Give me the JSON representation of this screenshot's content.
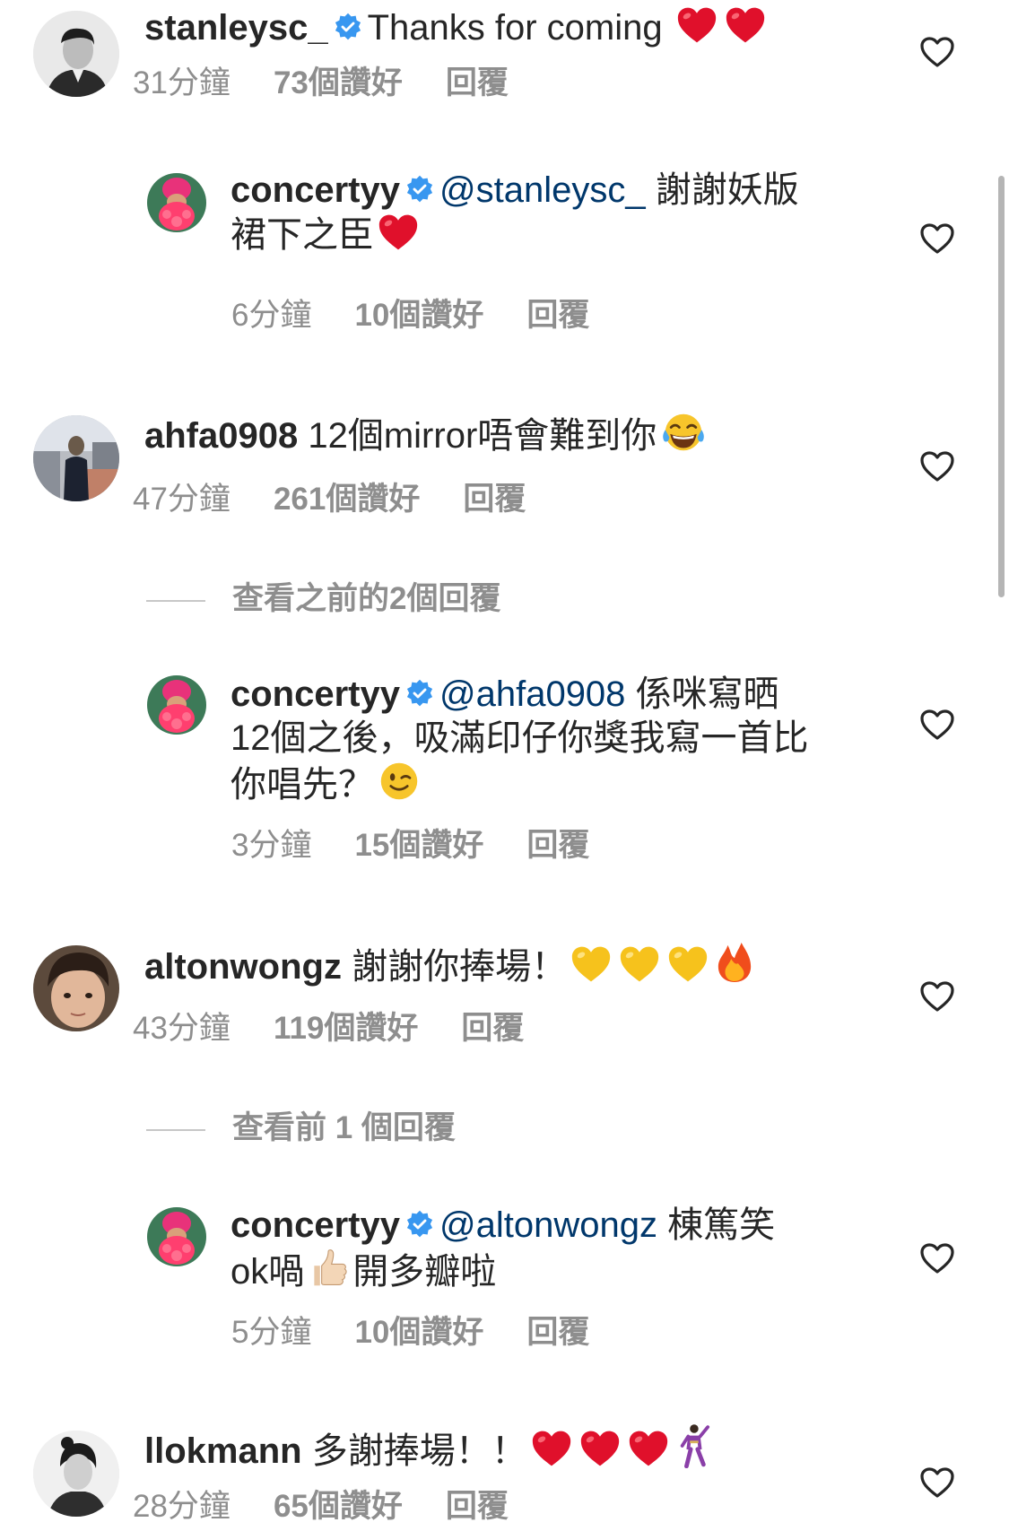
{
  "comments": [
    {
      "username": "stanleysc_",
      "text": "Thanks for coming",
      "emojis": [
        "red-heart",
        "red-heart"
      ],
      "time": "31分鐘",
      "likes": "73個讚好",
      "reply": "回覆"
    },
    {
      "username": "concertyy",
      "mention": "@stanleysc_",
      "text_line1": "謝謝妖版",
      "text_line2": "裙下之臣",
      "emojis": [
        "red-heart"
      ],
      "time": "6分鐘",
      "likes": "10個讚好",
      "reply": "回覆"
    },
    {
      "username": "ahfa0908",
      "text": "12個mirror唔會難到你",
      "emojis": [
        "tears-of-joy"
      ],
      "time": "47分鐘",
      "likes": "261個讚好",
      "reply": "回覆"
    },
    {
      "view_replies": "查看之前的2個回覆"
    },
    {
      "username": "concertyy",
      "mention": "@ahfa0908",
      "text_line1": "係咪寫晒",
      "text_line2": "12個之後，吸滿印仔你獎我寫一首比",
      "text_line3": "你唱先？",
      "emojis": [
        "winking-face"
      ],
      "time": "3分鐘",
      "likes": "15個讚好",
      "reply": "回覆"
    },
    {
      "username": "altonwongz",
      "text": "謝謝你捧場！",
      "emojis": [
        "yellow-heart",
        "yellow-heart",
        "yellow-heart",
        "fire"
      ],
      "time": "43分鐘",
      "likes": "119個讚好",
      "reply": "回覆"
    },
    {
      "view_replies": "查看前 1 個回覆"
    },
    {
      "username": "concertyy",
      "mention": "@altonwongz",
      "text_line1": "棟篤笑",
      "text_line2a": "ok喎",
      "text_line2b": "開多瓣啦",
      "emojis": [
        "thumbs-up"
      ],
      "time": "5分鐘",
      "likes": "10個讚好",
      "reply": "回覆"
    },
    {
      "username": "llokmann",
      "text": "多謝捧場！！",
      "emojis": [
        "red-heart",
        "red-heart",
        "red-heart",
        "dancer"
      ],
      "time": "28分鐘",
      "likes": "65個讚好",
      "reply": "回覆"
    }
  ],
  "colors": {
    "text": "#262626",
    "meta": "#8e8e8e",
    "verified": "#3897f0",
    "red_heart": "#e0102b",
    "yellow_heart": "#f6c21c"
  }
}
